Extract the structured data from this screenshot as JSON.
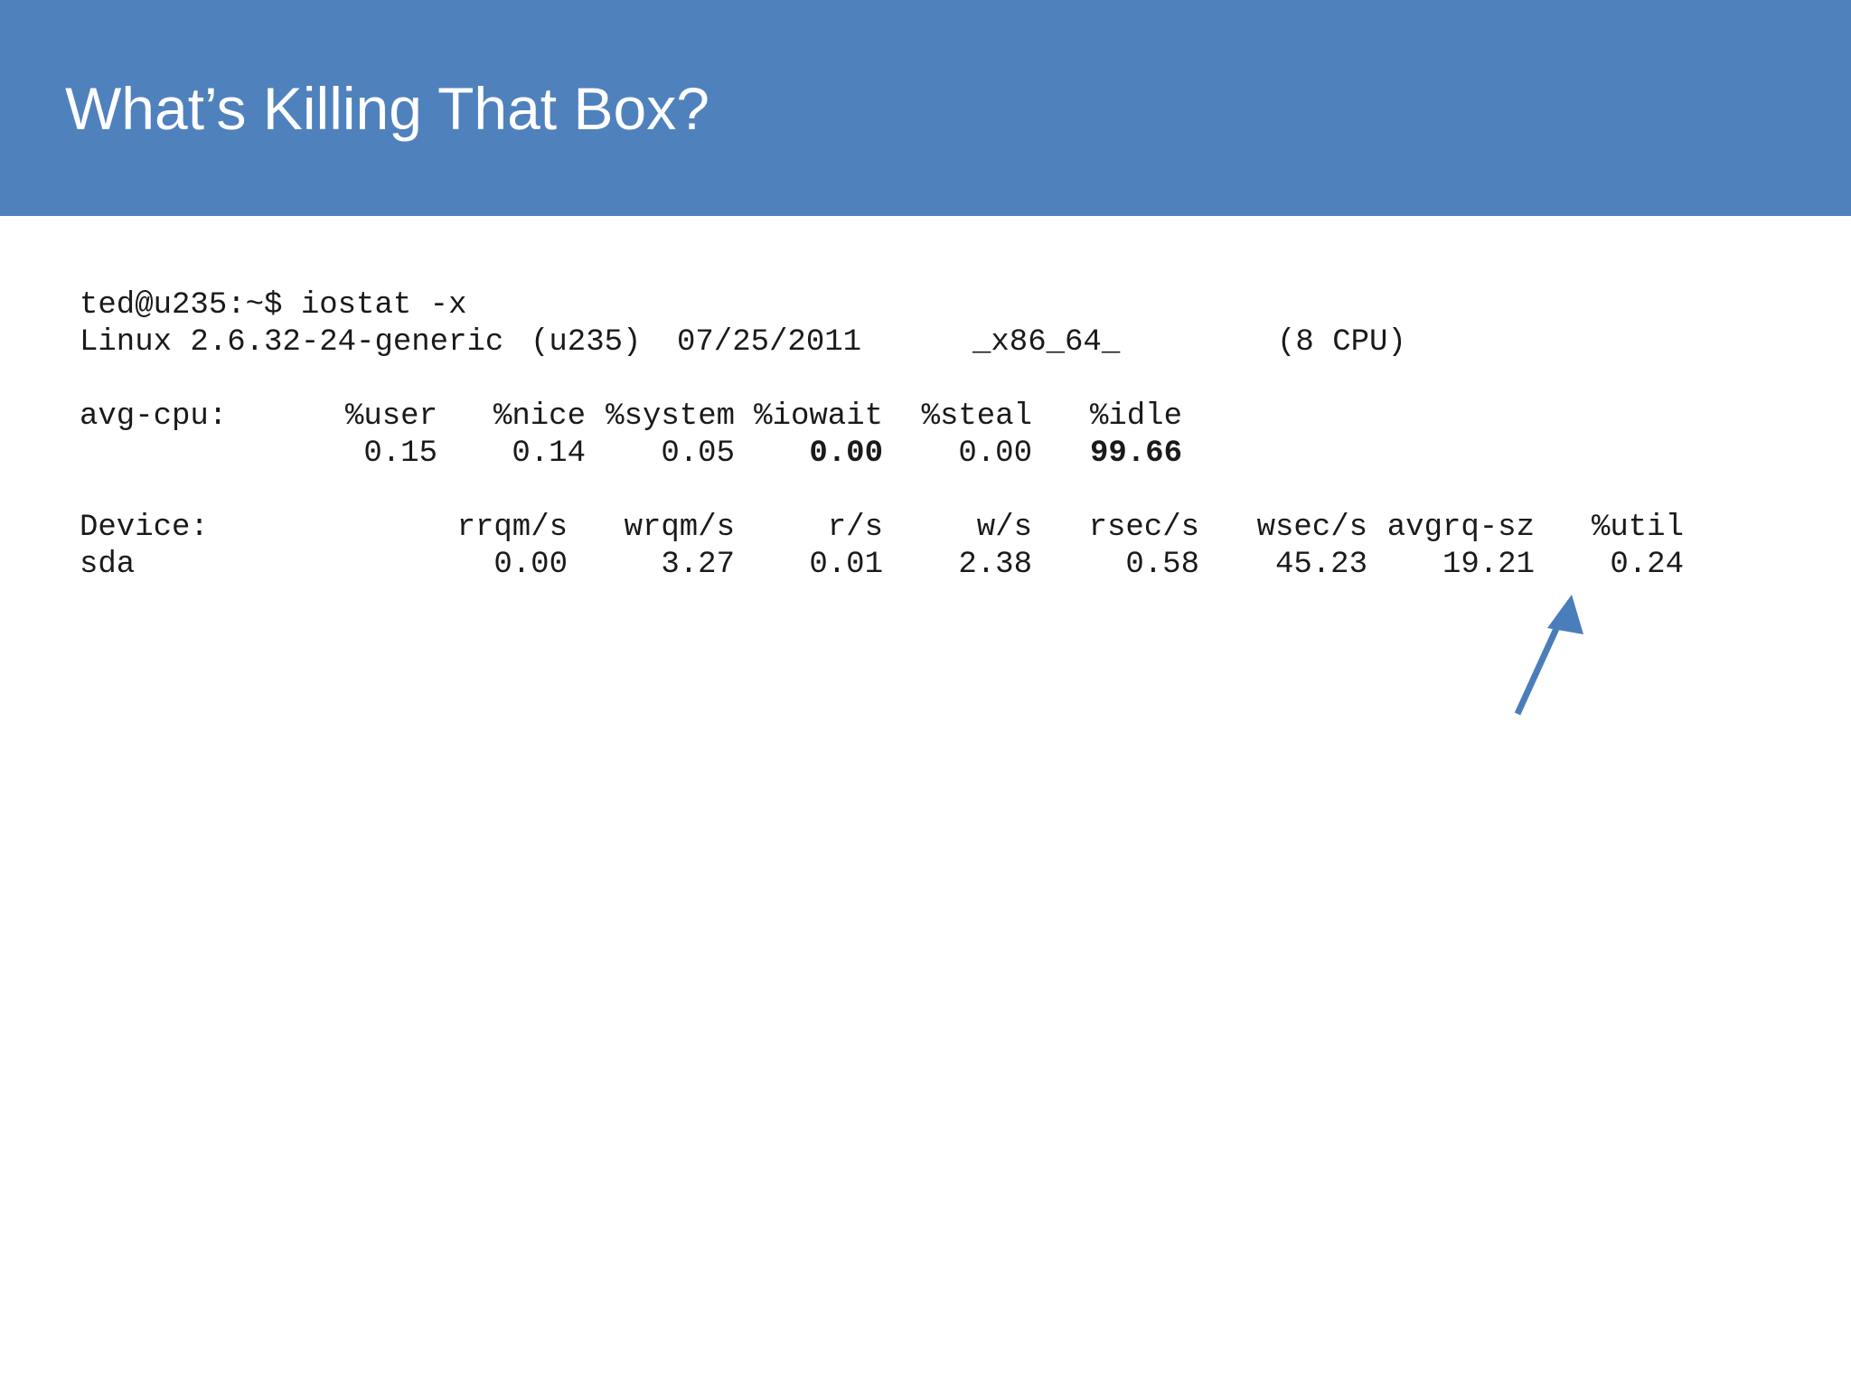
{
  "slide": {
    "title": "What’s Killing That Box?"
  },
  "terminal": {
    "prompt_line": "ted@u235:~$ iostat -x",
    "system": {
      "kernel": "Linux 2.6.32-24-generic",
      "host": "(u235)",
      "date": "07/25/2011",
      "arch": "_x86_64_",
      "cpus": "(8 CPU)"
    },
    "cpu": {
      "label": "avg-cpu:",
      "headers": [
        "%user",
        "%nice",
        "%system",
        "%iowait",
        "%steal",
        "%idle"
      ],
      "values": [
        "0.15",
        "0.14",
        "0.05",
        "0.00",
        "0.00",
        "99.66"
      ]
    },
    "device": {
      "label": "Device:",
      "headers": [
        "rrqm/s",
        "wrqm/s",
        "r/s",
        "w/s",
        "rsec/s",
        "wsec/s",
        "avgrq-sz",
        "%util"
      ],
      "name": "sda",
      "values": [
        "0.00",
        "3.27",
        "0.01",
        "2.38",
        "0.58",
        "45.23",
        "19.21",
        "0.24"
      ]
    }
  },
  "colors": {
    "title_bar": "#4f81bd",
    "title_text": "#ffffff",
    "arrow": "#4a7ebb",
    "terminal_text": "#1a1a1a"
  },
  "icons": {
    "pointer": "arrow-up-right-icon"
  }
}
